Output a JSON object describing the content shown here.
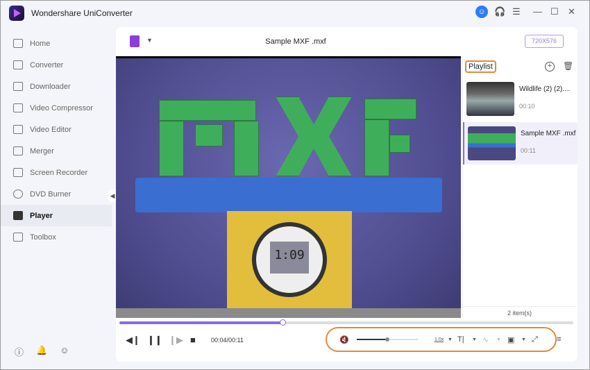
{
  "app": {
    "title": "Wondershare UniConverter"
  },
  "sidebar": {
    "items": [
      {
        "label": "Home"
      },
      {
        "label": "Converter"
      },
      {
        "label": "Downloader"
      },
      {
        "label": "Video Compressor"
      },
      {
        "label": "Video Editor"
      },
      {
        "label": "Merger"
      },
      {
        "label": "Screen Recorder"
      },
      {
        "label": "DVD Burner"
      },
      {
        "label": "Player",
        "active": true
      },
      {
        "label": "Toolbox"
      }
    ]
  },
  "player": {
    "file_name": "Sample MXF .mxf",
    "resolution": "720X576",
    "clock_text": "1:09",
    "current_time": "00:04/00:11",
    "progress_fraction": 0.36,
    "volume_fraction": 0.5,
    "speed": "1.0x"
  },
  "playlist": {
    "title": "Playlist",
    "items": [
      {
        "name": "Wildlife  (2) (2)....",
        "duration": "00:10"
      },
      {
        "name": "Sample MXF .mxf",
        "duration": "00:11",
        "selected": true
      }
    ],
    "count": "2 item(s)"
  },
  "colors": {
    "accent": "#8a6ce0",
    "highlight": "#e08a3c"
  }
}
